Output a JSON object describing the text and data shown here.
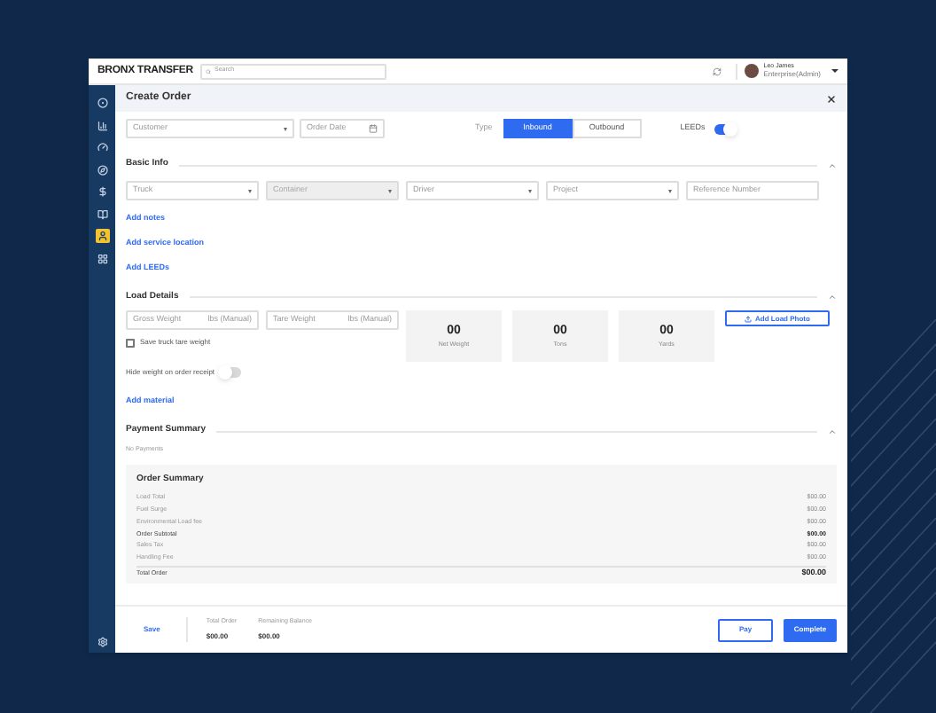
{
  "header": {
    "logo": "BRONX TRANSFER",
    "search": {
      "placeholder": "Search"
    },
    "user": {
      "name": "Leo James",
      "role": "Enterprise(Admin)"
    }
  },
  "sidebar": {
    "items": [
      {
        "selected": false
      },
      {
        "selected": false
      },
      {
        "selected": false
      },
      {
        "selected": false
      },
      {
        "selected": false
      },
      {
        "selected": false
      },
      {
        "selected": true
      },
      {
        "selected": false
      }
    ]
  },
  "title": "Create Order",
  "order": {
    "customer": {
      "placeholder": "Customer"
    },
    "date": {
      "placeholder": "Order Date"
    },
    "type_label": "Type",
    "types": [
      {
        "label": "Inbound",
        "selected": true
      },
      {
        "label": "Outbound",
        "selected": false
      }
    ],
    "leeds": {
      "label": "LEEDs",
      "on": true
    }
  },
  "basic_info": {
    "heading": "Basic Info",
    "fields": [
      {
        "placeholder": "Truck",
        "kind": "select",
        "disabled": false
      },
      {
        "placeholder": "Container",
        "kind": "select",
        "disabled": true
      },
      {
        "placeholder": "Driver",
        "kind": "select",
        "disabled": false
      },
      {
        "placeholder": "Project",
        "kind": "select",
        "disabled": false
      },
      {
        "placeholder": "Reference Number",
        "kind": "text",
        "disabled": false
      }
    ],
    "links": [
      "Add notes",
      "Add service location",
      "Add LEEDs"
    ]
  },
  "load_details": {
    "heading": "Load Details",
    "weights": [
      {
        "placeholder": "Gross Weight",
        "unit": "lbs (Manual)"
      },
      {
        "placeholder": "Tare Weight",
        "unit": "lbs (Manual)"
      }
    ],
    "save_tare": {
      "label": "Save truck tare weight",
      "checked": false
    },
    "stats": [
      {
        "value": "00",
        "label": "Net Weight"
      },
      {
        "value": "00",
        "label": "Tons"
      },
      {
        "value": "00",
        "label": "Yards"
      }
    ],
    "photo_button": "Add Load Photo",
    "hide_weight": {
      "label": "Hide weight on order receipt",
      "on": false
    },
    "add_material": "Add material"
  },
  "payment_summary": {
    "heading": "Payment Summary",
    "note": "No Payments"
  },
  "order_summary": {
    "title": "Order Summary",
    "lines": [
      {
        "label": "Load Total",
        "amount": "$00.00",
        "kind": "line"
      },
      {
        "label": "Fuel Surge",
        "amount": "$00.00",
        "kind": "line"
      },
      {
        "label": "Environmental Load fee",
        "amount": "$00.00",
        "kind": "line"
      },
      {
        "label": "Order Subtotal",
        "amount": "$00.00",
        "kind": "subtotal"
      },
      {
        "label": "Sales Tax",
        "amount": "$00.00",
        "kind": "line"
      },
      {
        "label": "Handling Fee",
        "amount": "$00.00",
        "kind": "line"
      },
      {
        "label": "Total Order",
        "amount": "$00.00",
        "kind": "total"
      }
    ]
  },
  "footer": {
    "save": "Save",
    "totals": [
      {
        "label": "Total Order",
        "value": "$00.00"
      },
      {
        "label": "Remaining Balance",
        "value": "$00.00"
      }
    ],
    "pay": "Pay",
    "complete": "Complete"
  }
}
